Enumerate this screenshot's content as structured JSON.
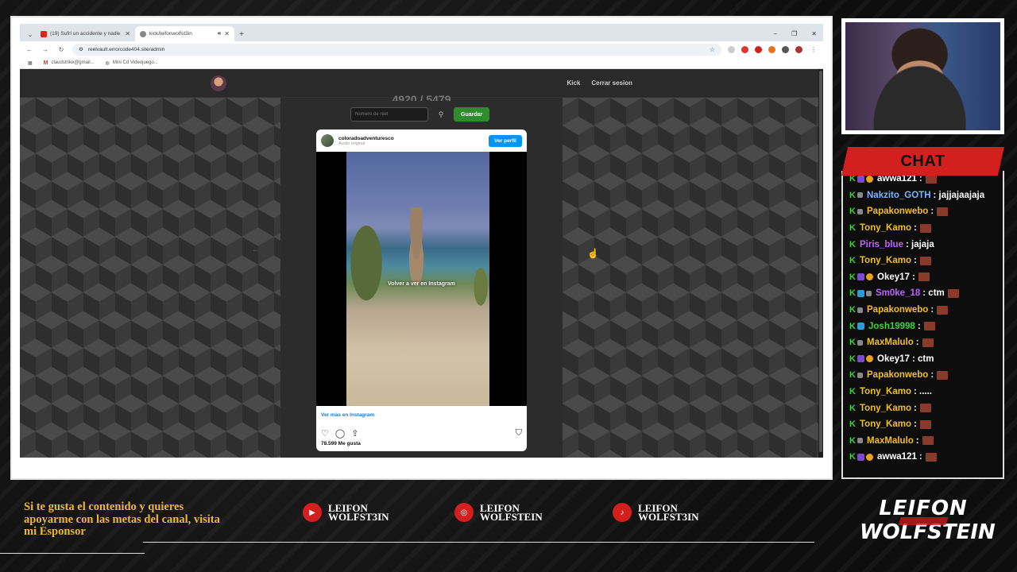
{
  "browser": {
    "tabs": [
      {
        "title": "(19) Sufrí un accidente y nadie",
        "favicon": "youtube-icon",
        "active": false
      },
      {
        "title": "kick/leifonwolfst3in",
        "favicon": "kick-icon",
        "active": true
      }
    ],
    "url": "reelvault.errorcode404.site/admin",
    "bookmarks": [
      "claudstrike@gmail...",
      "Mini Cd Videojuego..."
    ]
  },
  "site": {
    "nav_links": [
      "Kick",
      "Cerrar sesion"
    ],
    "counter_partial": "4920 / 5479",
    "reel_input_placeholder": "Número de reel",
    "save_label": "Guardar"
  },
  "instagram": {
    "username": "coloradoadventuresco",
    "subtitle": "Audio original",
    "profile_button": "Ver perfil",
    "overlay_text": "Volver a ver en Instagram",
    "see_more": "Ver más en Instagram",
    "likes": "78.599 Me gusta"
  },
  "chat": {
    "title": "CHAT",
    "messages": [
      {
        "user": "awwa121",
        "color": "#ffffff",
        "badges": [
          "sub",
          "coin"
        ],
        "text": ":",
        "emote": true
      },
      {
        "user": "Nakzito_GOTH",
        "color": "#7ab4ff",
        "badges": [
          "tool"
        ],
        "text": ": jajjajaajaja",
        "emote": false
      },
      {
        "user": "Papakonwebo",
        "color": "#f0c020",
        "badges": [
          "tool"
        ],
        "text": ":",
        "emote": true
      },
      {
        "user": "Tony_Kamo",
        "color": "#f0c020",
        "badges": [],
        "text": ":",
        "emote": true
      },
      {
        "user": "Piris_blue",
        "color": "#c060ff",
        "badges": [],
        "text": ": jajaja",
        "emote": false
      },
      {
        "user": "Tony_Kamo",
        "color": "#f0c020",
        "badges": [],
        "text": ":",
        "emote": true
      },
      {
        "user": "Okey17",
        "color": "#ffffff",
        "badges": [
          "sub",
          "coin"
        ],
        "text": ":",
        "emote": true
      },
      {
        "user": "Sm0ke_18",
        "color": "#c060ff",
        "badges": [
          "gem",
          "tool"
        ],
        "text": ": ctm",
        "emote": true
      },
      {
        "user": "Papakonwebo",
        "color": "#f0c020",
        "badges": [
          "tool"
        ],
        "text": ":",
        "emote": true
      },
      {
        "user": "Josh19998",
        "color": "#3bd23b",
        "badges": [
          "gem"
        ],
        "text": ":",
        "emote": true
      },
      {
        "user": "MaxMalulo",
        "color": "#f0c020",
        "badges": [
          "tool"
        ],
        "text": ":",
        "emote": true
      },
      {
        "user": "Okey17",
        "color": "#ffffff",
        "badges": [
          "sub",
          "coin"
        ],
        "text": ": ctm",
        "emote": false
      },
      {
        "user": "Papakonwebo",
        "color": "#f0c020",
        "badges": [
          "tool"
        ],
        "text": ":",
        "emote": true
      },
      {
        "user": "Tony_Kamo",
        "color": "#f0c020",
        "badges": [],
        "text": ": .....",
        "emote": false
      },
      {
        "user": "Tony_Kamo",
        "color": "#f0c020",
        "badges": [],
        "text": ":",
        "emote": true
      },
      {
        "user": "Tony_Kamo",
        "color": "#f0c020",
        "badges": [],
        "text": ":",
        "emote": true
      },
      {
        "user": "MaxMalulo",
        "color": "#f0c020",
        "badges": [
          "tool"
        ],
        "text": ":",
        "emote": true
      },
      {
        "user": "awwa121",
        "color": "#ffffff",
        "badges": [
          "sub",
          "coin"
        ],
        "text": ":",
        "emote": true
      }
    ]
  },
  "overlay": {
    "sponsor_text": "Si te gusta el contenido y quieres apoyarme con las metas del canal, visita mi Esponsor",
    "socials": [
      {
        "icon": "youtube-icon",
        "name_line1": "LEIFON",
        "name_line2": "WOLFST3IN"
      },
      {
        "icon": "instagram-icon",
        "name_line1": "LEIFON",
        "name_line2": "WOLFSTEIN"
      },
      {
        "icon": "tiktok-icon",
        "name_line1": "LEIFON",
        "name_line2": "WOLFST3IN"
      }
    ],
    "logo_line1": "LEIFON",
    "logo_line2": "WOLFSTEIN"
  },
  "colors": {
    "accent": "#d41f1f",
    "sponsor": "#f0b830",
    "kick": "#3bd23b",
    "ig_button": "#0095f6",
    "save_button": "#2e8b2e"
  }
}
